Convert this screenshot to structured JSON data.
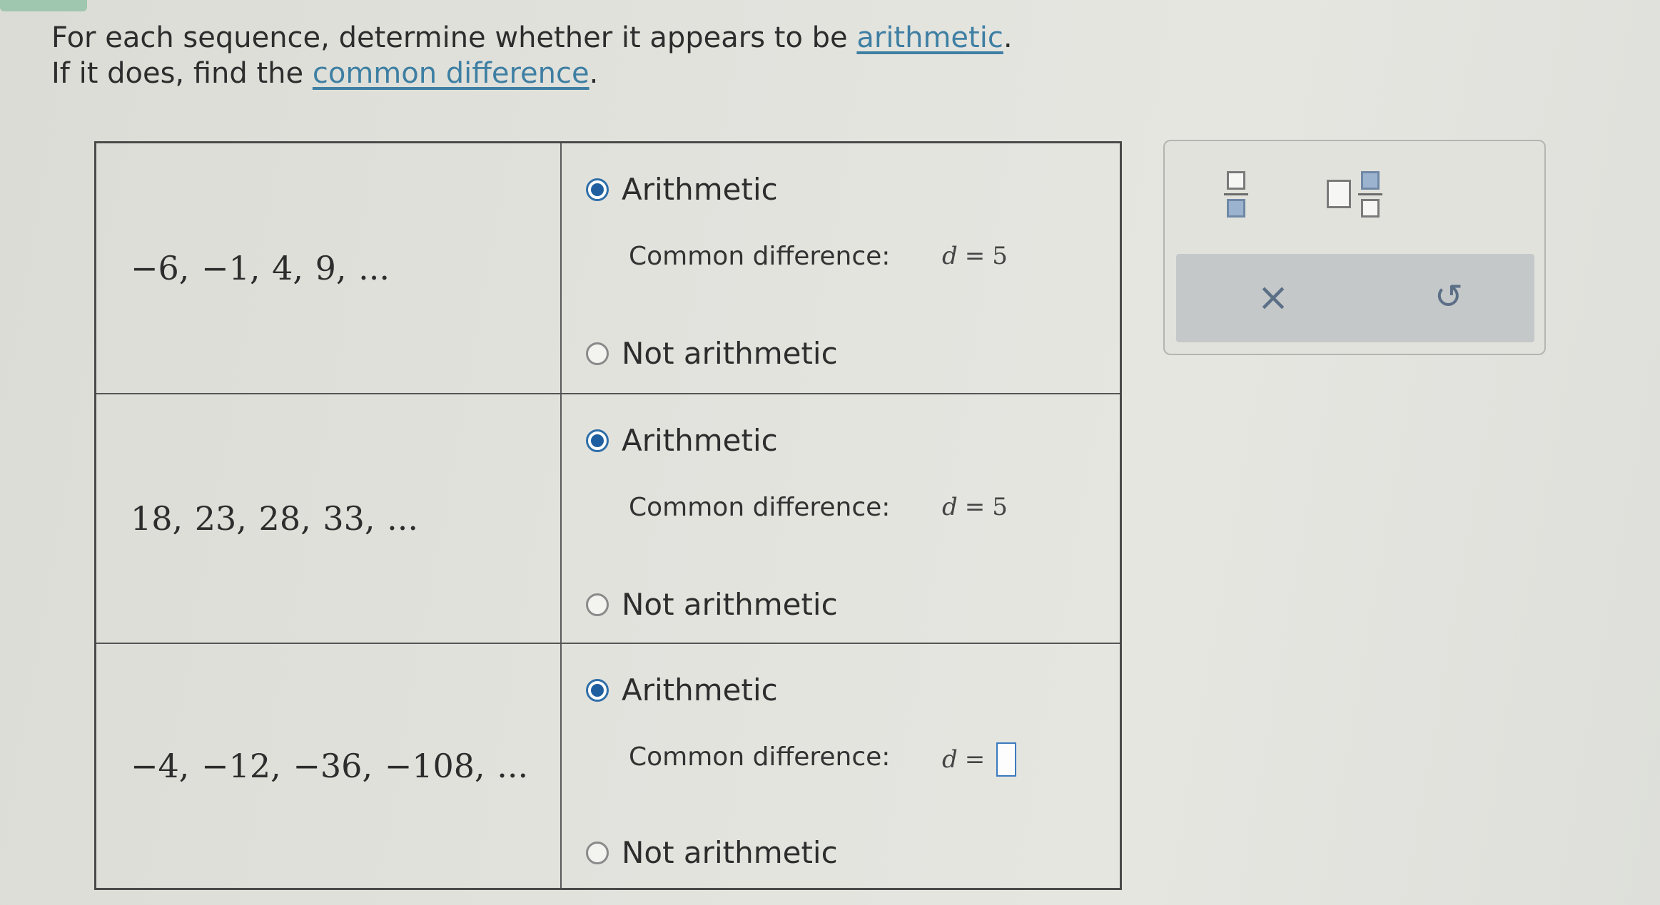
{
  "instructions": {
    "line1_prefix": "For each sequence, determine whether it appears to be ",
    "line1_link": "arithmetic",
    "line1_suffix": ".",
    "line2_prefix": "If it does, find the ",
    "line2_link": "common difference",
    "line2_suffix": "."
  },
  "rows": [
    {
      "sequence": "−6, −1, 4, 9, ...",
      "option_arithmetic": "Arithmetic",
      "option_not": "Not arithmetic",
      "selected": "arithmetic",
      "difference_label": "Common difference:",
      "difference_var": "d",
      "difference_eq": "=",
      "difference_value": "5"
    },
    {
      "sequence": "18, 23, 28, 33, ...",
      "option_arithmetic": "Arithmetic",
      "option_not": "Not arithmetic",
      "selected": "arithmetic",
      "difference_label": "Common difference:",
      "difference_var": "d",
      "difference_eq": "=",
      "difference_value": "5"
    },
    {
      "sequence": "−4, −12, −36, −108, ...",
      "option_arithmetic": "Arithmetic",
      "option_not": "Not arithmetic",
      "selected": "arithmetic",
      "difference_label": "Common difference:",
      "difference_var": "d",
      "difference_eq": "=",
      "difference_value": ""
    }
  ],
  "palette": {
    "clear_symbol": "×",
    "undo_symbol": "↺",
    "icons": [
      "fraction-icon",
      "mixed-number-icon",
      "clear-icon",
      "undo-icon"
    ]
  },
  "colors": {
    "link": "#3e7fa3",
    "radio_selected": "#1f5fa0",
    "answer_box_border": "#3b7bbf",
    "tab_accent": "#9fc7b0"
  }
}
